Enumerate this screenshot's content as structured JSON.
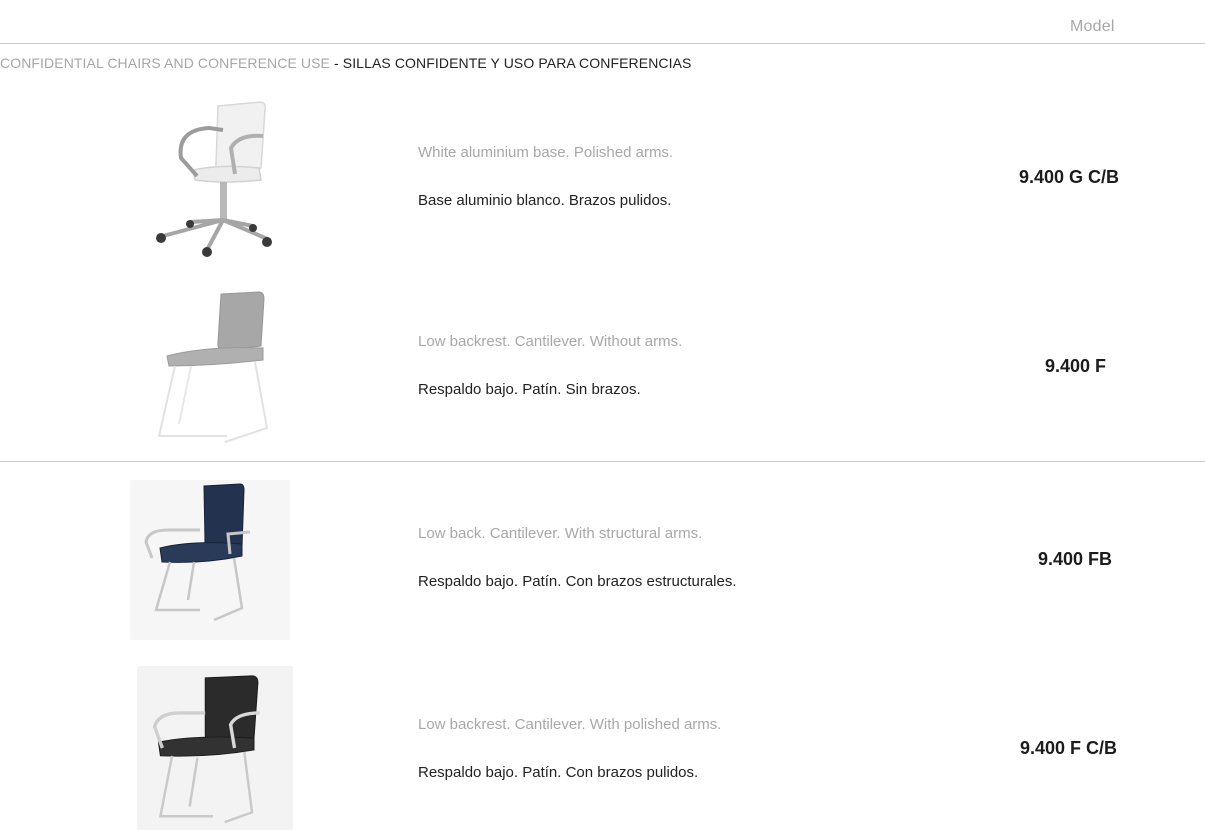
{
  "header": {
    "model_label": "Model"
  },
  "section": {
    "title_en": "CONFIDENTIAL CHAIRS AND CONFERENCE USE",
    "separator": " - ",
    "title_es": "SILLAS CONFIDENTE Y USO PARA CONFERENCIAS"
  },
  "products": [
    {
      "desc_en": "White aluminium base. Polished arms.",
      "desc_es": "Base aluminio blanco. Brazos pulidos.",
      "model": "9.400 G C/B",
      "image": "white-swivel-chair-with-arms"
    },
    {
      "desc_en": "Low backrest. Cantilever. Without arms.",
      "desc_es": "Respaldo bajo. Patín. Sin brazos.",
      "model": "9.400 F",
      "image": "grey-sled-chair-without-arms"
    },
    {
      "desc_en": "Low back. Cantilever. With structural arms.",
      "desc_es": "Respaldo bajo. Patín. Con brazos estructurales.",
      "model": "9.400 FB",
      "image": "navy-sled-chair-with-arms"
    },
    {
      "desc_en": "Low backrest. Cantilever. With polished arms.",
      "desc_es": "Respaldo bajo. Patín. Con brazos pulidos.",
      "model": "9.400 F C/B",
      "image": "black-sled-chair-with-polished-arms"
    }
  ]
}
